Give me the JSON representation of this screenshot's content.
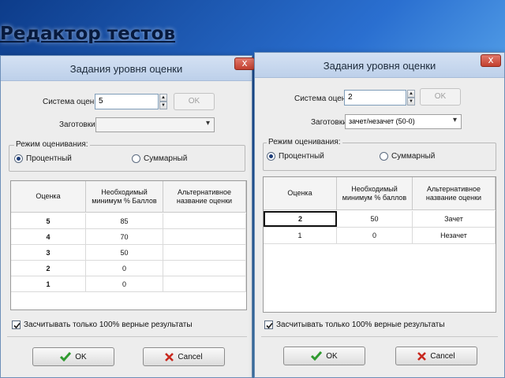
{
  "slide_title": "Редактор тестов",
  "dialog_left": {
    "title": "Задания уровня оценки",
    "close_label": "x",
    "grading_system_label": "Система оценки:",
    "grading_system_value": "5",
    "ok_small_label": "OK",
    "presets_label": "Заготовки:",
    "presets_value": "",
    "mode_group_label": "Режим оценивания:",
    "radio_percent": "Процентный",
    "radio_total": "Суммарный",
    "columns": [
      "Оценка",
      "Необходимый минимум % Баллов",
      "Альтернативное название оценки"
    ],
    "rows": [
      {
        "grade": "5",
        "min": "85",
        "alt": ""
      },
      {
        "grade": "4",
        "min": "70",
        "alt": ""
      },
      {
        "grade": "3",
        "min": "50",
        "alt": ""
      },
      {
        "grade": "2",
        "min": "0",
        "alt": ""
      },
      {
        "grade": "1",
        "min": "0",
        "alt": ""
      }
    ],
    "checkbox_label": "Засчитывать только 100% верные результаты",
    "ok_label": "OK",
    "cancel_label": "Cancel"
  },
  "dialog_right": {
    "title": "Задания уровня оценки",
    "close_label": "x",
    "grading_system_label": "Система оценки:",
    "grading_system_value": "2",
    "ok_small_label": "OK",
    "presets_label": "Заготовки:",
    "presets_value": "зачет/незачет (50-0)",
    "mode_group_label": "Режим оценивания:",
    "radio_percent": "Процентный",
    "radio_total": "Суммарный",
    "columns": [
      "Оценка",
      "Необходимый минимум % баллов",
      "Альтернативное название оценки"
    ],
    "rows": [
      {
        "grade": "2",
        "min": "50",
        "alt": "Зачет"
      },
      {
        "grade": "1",
        "min": "0",
        "alt": "Незачет"
      }
    ],
    "checkbox_label": "Засчитывать только 100% верные результаты",
    "ok_label": "OK",
    "cancel_label": "Cancel"
  },
  "colors": {
    "check_green": "#2f9a2f",
    "cancel_red": "#c8281e",
    "close_red": "#c2402f"
  }
}
